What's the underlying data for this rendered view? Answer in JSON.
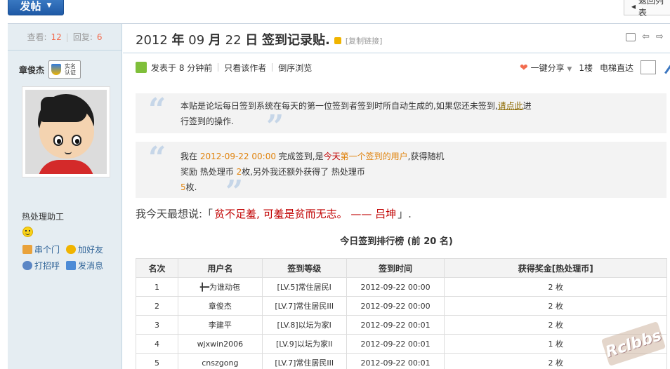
{
  "topbar": {
    "post_label": "发帖",
    "back_label": "返回列表"
  },
  "sidebar": {
    "views_label": "查看:",
    "views": "12",
    "replies_label": "回复:",
    "replies": "6",
    "username": "章俊杰",
    "badge_text": "实名认证",
    "user_title": "热处理助工",
    "links": [
      {
        "label": "串个门",
        "icon": "home-icon"
      },
      {
        "label": "加好友",
        "icon": "add-friend-icon"
      },
      {
        "label": "打招呼",
        "icon": "greet-icon"
      },
      {
        "label": "发消息",
        "icon": "mail-icon"
      }
    ]
  },
  "thread": {
    "title_prefix": "2012",
    "title_y": "年",
    "title_m_num": "09",
    "title_m": "月",
    "title_d_num": "22",
    "title_d": "日",
    "title_bold": "签到记录贴.",
    "copy_link": "[复制链接]"
  },
  "meta": {
    "posted": "发表于 8 分钟前",
    "only_author": "只看该作者",
    "reverse": "倒序浏览",
    "share": "一键分享",
    "floor": "1楼",
    "elevator": "电梯直达"
  },
  "quote1": {
    "text_before": "本贴是论坛每日签到系统在每天的第一位签到者签到时所自动生成的,如果您还未签到,",
    "link": "请点此",
    "text_after": "进",
    "line2": "行签到的操作."
  },
  "quote2": {
    "t1": "我在 ",
    "time": "2012-09-22 00:00",
    "t2": " 完成签到,是",
    "today": "今天",
    "first": "第一个签到的用户",
    "t3": ",获得随机",
    "line2a": "奖励 热处理币 ",
    "coins": "2",
    "line2b": "枚,另外我还额外获得了 热处理币",
    "extra": "5",
    "line3": "枚."
  },
  "motto": {
    "prefix": "我今天最想说:「",
    "quote": "贫不足羞, 可羞是贫而无志。 —— 吕坤",
    "suffix": "」."
  },
  "ranking": {
    "title": "今日签到排行榜 (前 20 名)",
    "headers": [
      "名次",
      "用户名",
      "签到等级",
      "签到时间",
      "获得奖金[热处理币]"
    ],
    "rows": [
      [
        "1",
        "╋━为谁动㐌",
        "[LV.5]常住居民I",
        "2012-09-22 00:00",
        "2 枚"
      ],
      [
        "2",
        "章俊杰",
        "[LV.7]常住居民III",
        "2012-09-22 00:00",
        "2 枚"
      ],
      [
        "3",
        "李建平",
        "[LV.8]以坛为家I",
        "2012-09-22 00:01",
        "2 枚"
      ],
      [
        "4",
        "wjxwin2006",
        "[LV.9]以坛为家II",
        "2012-09-22 00:01",
        "1 枚"
      ],
      [
        "5",
        "cnszgong",
        "[LV.7]常住居民III",
        "2012-09-22 00:01",
        "2 枚"
      ]
    ]
  },
  "watermark": "Rclbbs",
  "colors": {
    "accent": "#336699",
    "highlight_red": "#c00000",
    "highlight_orange": "#e0820b",
    "sidebar_bg": "#e5edf2"
  }
}
